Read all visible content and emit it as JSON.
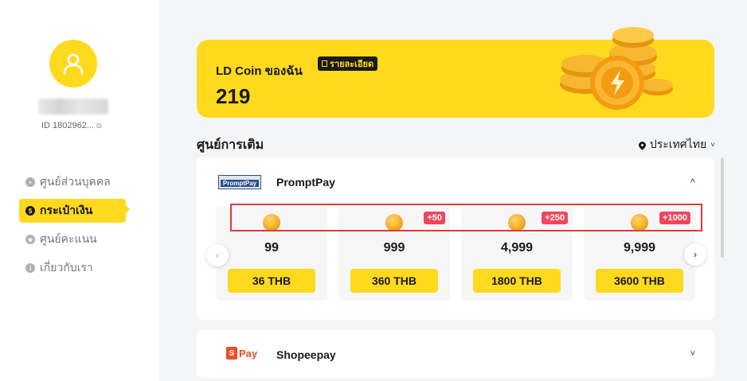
{
  "sidebar": {
    "user_id": "ID 1802962...",
    "copy_glyph": "⧉",
    "items": [
      {
        "label": "ศูนย์ส่วนบุคคล",
        "icon": "person-icon",
        "glyph": "•"
      },
      {
        "label": "กระเป๋าเงิน",
        "icon": "wallet-icon",
        "glyph": "$"
      },
      {
        "label": "ศูนย์คะแนน",
        "icon": "star-icon",
        "glyph": "★"
      },
      {
        "label": "เกี่ยวกับเรา",
        "icon": "info-icon",
        "glyph": "i"
      }
    ]
  },
  "banner": {
    "title": "LD Coin ของฉัน",
    "detail_label": "รายละเอียด",
    "coin_count": "219"
  },
  "section": {
    "title": "ศูนย์การเติม",
    "country": "ประเทศไทย",
    "country_caret": "˅"
  },
  "payments": {
    "promptpay": {
      "name": "PromptPay",
      "logo_text": "PromptPay",
      "collapse_glyph": "˄",
      "packages": [
        {
          "amount": "99",
          "bonus": "",
          "price": "36 THB"
        },
        {
          "amount": "999",
          "bonus": "+50",
          "price": "360 THB"
        },
        {
          "amount": "4,999",
          "bonus": "+250",
          "price": "1800 THB"
        },
        {
          "amount": "9,999",
          "bonus": "+1000",
          "price": "3600 THB"
        }
      ],
      "arrow_left": "‹",
      "arrow_right": "›"
    },
    "shopeepay": {
      "name": "Shopeepay",
      "logo_bag": "S",
      "logo_text": "Pay",
      "expand_glyph": "˅"
    }
  },
  "colors": {
    "accent": "#ffd91e",
    "bonus": "#f0455e",
    "highlight": "#e03a3a"
  }
}
